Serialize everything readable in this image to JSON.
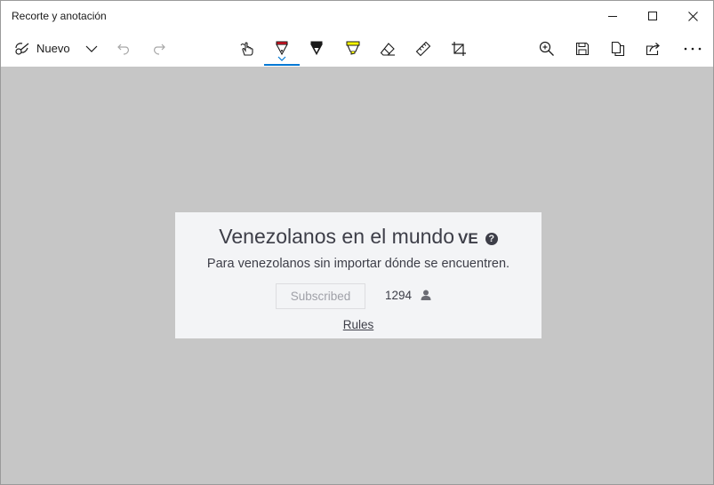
{
  "window": {
    "title": "Recorte y anotación"
  },
  "toolbar": {
    "new_label": "Nuevo",
    "icons": [
      "snip-icon",
      "chevron-down-icon",
      "undo-icon",
      "redo-icon",
      "touch-writing-icon",
      "ballpoint-pen-icon",
      "pencil-icon",
      "highlighter-icon",
      "eraser-icon",
      "ruler-icon",
      "crop-icon",
      "zoom-icon",
      "save-icon",
      "copy-icon",
      "share-icon",
      "more-icon"
    ]
  },
  "card": {
    "title": "Venezolanos en el mundo",
    "flag": "VE",
    "description": "Para venezolanos sin importar dónde se encuentren.",
    "subscribe_label": "Subscribed",
    "subscriber_count": "1294",
    "rules_label": "Rules"
  },
  "colors": {
    "accent": "#0078d4",
    "canvas": "#c6c6c6",
    "card_bg": "#f3f4f6",
    "card_text": "#3d3e48",
    "pen_red": "#e81123",
    "highlighter_yellow": "#ffff00"
  }
}
